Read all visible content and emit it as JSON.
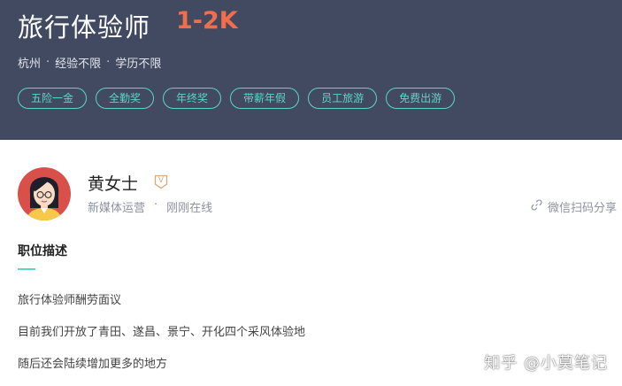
{
  "job": {
    "title": "旅行体验师",
    "salary": "1-2K",
    "city": "杭州",
    "experience": "经验不限",
    "education": "学历不限",
    "separator": "·",
    "tags": [
      "五险一金",
      "全勤奖",
      "年终奖",
      "带薪年假",
      "员工旅游",
      "免费出游"
    ]
  },
  "recruiter": {
    "name": "黄女士",
    "badge": "V",
    "role": "新媒体运营",
    "separator": "·",
    "status": "刚刚在线"
  },
  "share": {
    "label": "微信扫码分享"
  },
  "description": {
    "title": "职位描述",
    "lines": [
      "旅行体验师酬劳面议",
      "目前我们开放了青田、遂昌、景宁、开化四个采风体验地",
      "随后还会陆续增加更多的地方"
    ]
  },
  "watermark": "知乎 @小莫笔记",
  "colors": {
    "header_bg": "#414a60",
    "salary": "#f26d49",
    "tag_accent": "#5dd5c8",
    "badge": "#d9a87a"
  }
}
